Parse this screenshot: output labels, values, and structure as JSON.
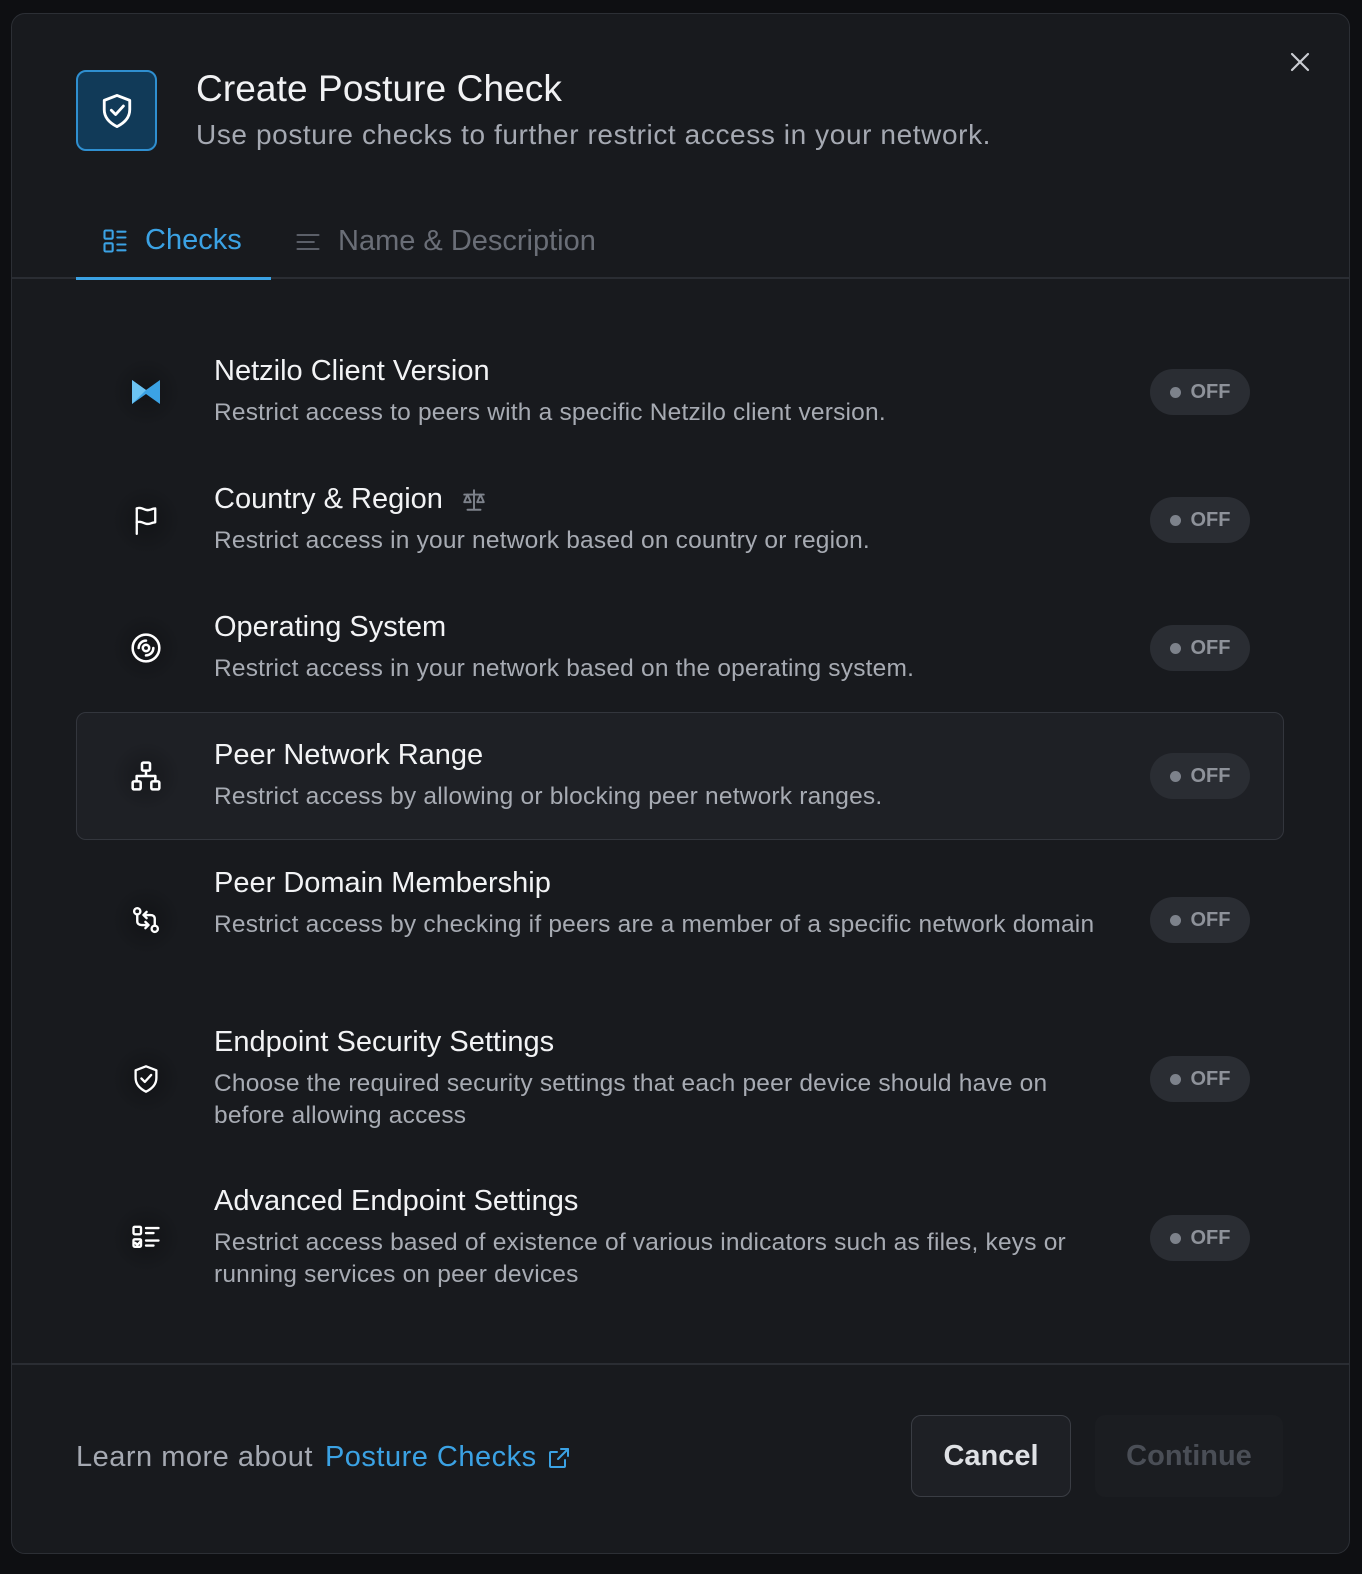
{
  "dialog": {
    "title": "Create Posture Check",
    "subtitle": "Use posture checks to further restrict access in your network."
  },
  "tabs": [
    {
      "label": "Checks",
      "active": true
    },
    {
      "label": "Name & Description",
      "active": false
    }
  ],
  "checks": [
    {
      "title": "Netzilo Client Version",
      "description": "Restrict access to peers with a specific Netzilo client version.",
      "status": "OFF",
      "icon": "netzilo-logo-icon"
    },
    {
      "title": "Country & Region",
      "description": "Restrict access in your network based on country or region.",
      "status": "OFF",
      "icon": "flag-icon",
      "badge_icon": "scale-icon"
    },
    {
      "title": "Operating System",
      "description": "Restrict access in your network based on the operating system.",
      "status": "OFF",
      "icon": "disc-icon"
    },
    {
      "title": "Peer Network Range",
      "description": "Restrict access by allowing or blocking peer network ranges.",
      "status": "OFF",
      "icon": "network-icon",
      "highlighted": true
    },
    {
      "title": "Peer Domain Membership",
      "description": "Restrict access by checking if peers are a member of a specific network domain",
      "status": "OFF",
      "icon": "git-compare-icon"
    },
    {
      "title": "Endpoint Security Settings",
      "description": "Choose the required security settings that each peer device should have on before allowing access",
      "status": "OFF",
      "icon": "shield-check-icon"
    },
    {
      "title": "Advanced Endpoint Settings",
      "description": "Restrict access based of existence of various indicators such as files, keys or running services on peer devices",
      "status": "OFF",
      "icon": "list-check-icon"
    }
  ],
  "footer": {
    "learn_prefix": "Learn more about",
    "learn_link": "Posture Checks",
    "cancel_label": "Cancel",
    "continue_label": "Continue"
  },
  "colors": {
    "accent": "#3ba2e4",
    "background": "#181a1e",
    "toggle_off": "#2a2d33"
  }
}
